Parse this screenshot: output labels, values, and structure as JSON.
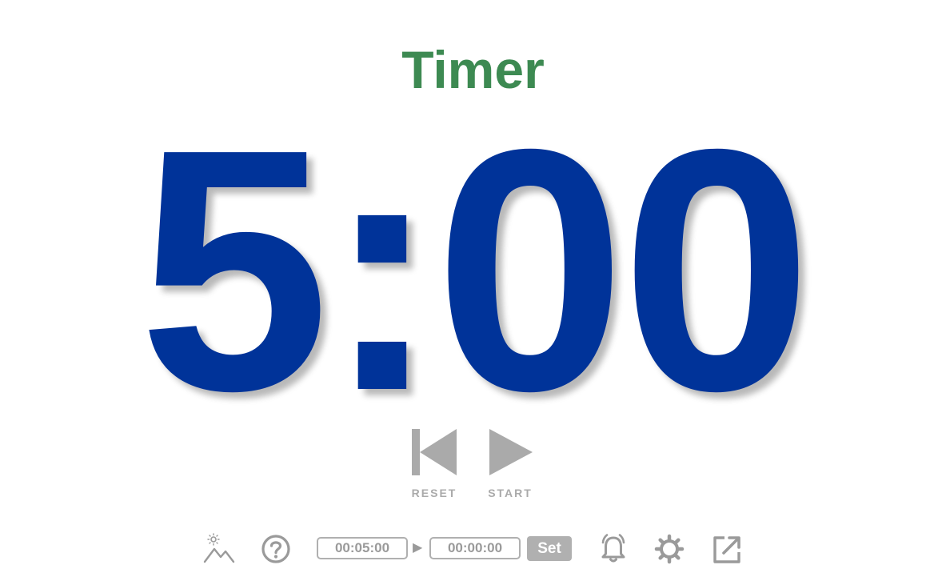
{
  "header": {
    "title": "Timer"
  },
  "clock": {
    "display": "5:00"
  },
  "controls": {
    "reset_label": "RESET",
    "start_label": "START"
  },
  "toolbar": {
    "from_time": "00:05:00",
    "to_time": "00:00:00",
    "set_label": "Set",
    "separator": "▶",
    "icons": [
      "theme-icon",
      "help-icon",
      "alarm-bell-icon",
      "settings-gear-icon",
      "open-external-icon"
    ]
  },
  "colors": {
    "title": "#3d8a52",
    "clock": "#003399",
    "controls": "#aaaaaa"
  }
}
